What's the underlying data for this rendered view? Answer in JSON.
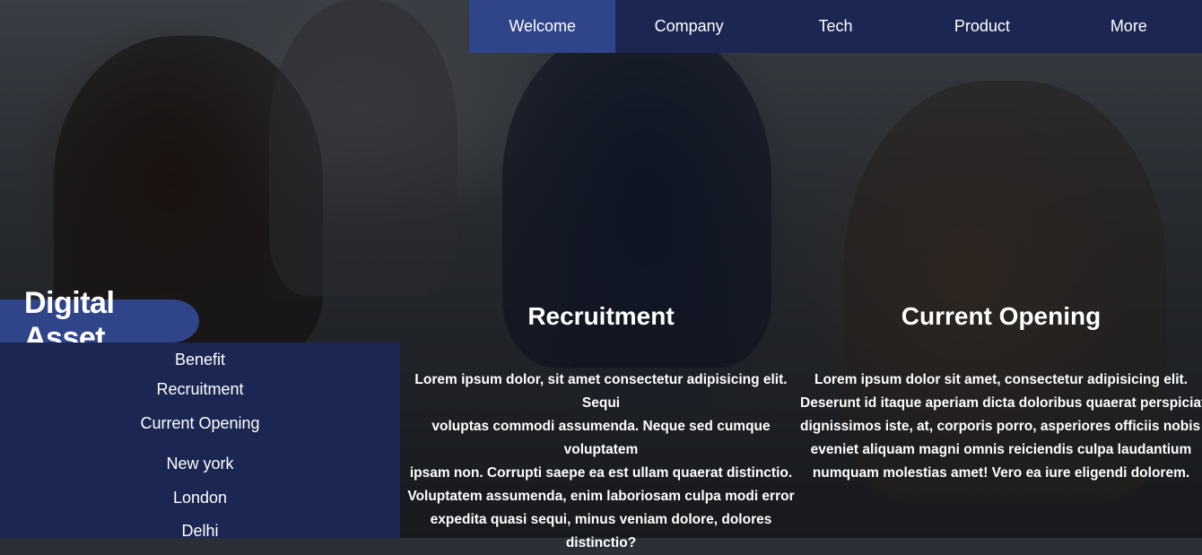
{
  "nav": {
    "items": [
      {
        "label": "Welcome",
        "active": true
      },
      {
        "label": "Company",
        "active": false
      },
      {
        "label": "Tech",
        "active": false
      },
      {
        "label": "Product",
        "active": false
      },
      {
        "label": "More",
        "active": false
      }
    ]
  },
  "brand": {
    "title": "Digital Asset"
  },
  "sidebar": {
    "items": [
      "Benefit",
      "Recruitment",
      "Current Opening",
      "New york",
      "London",
      "Delhi"
    ]
  },
  "sections": [
    {
      "title": "Recruitment",
      "lines": [
        "Lorem ipsum dolor, sit amet consectetur adipisicing elit. Sequi",
        "voluptas commodi assumenda. Neque sed cumque voluptatem",
        "ipsam non. Corrupti saepe ea est ullam quaerat distinctio.",
        "Voluptatem assumenda, enim laboriosam culpa modi error",
        "expedita quasi sequi, minus veniam dolore, dolores distinctio?"
      ]
    },
    {
      "title": "Current Opening",
      "lines": [
        "Lorem ipsum dolor sit amet, consectetur adipisicing elit.",
        "Deserunt id itaque aperiam dicta doloribus quaerat perspiciatis",
        "dignissimos iste, at, corporis porro, asperiores officiis nobis iusto",
        "eveniet aliquam magni omnis reiciendis culpa laudantium",
        "numquam molestias amet! Vero ea iure eligendi dolorem."
      ]
    }
  ],
  "colors": {
    "nav_bg": "#1b2752",
    "nav_active": "#2f4489",
    "brand_bg": "#2f4489",
    "text": "#ffffff"
  }
}
